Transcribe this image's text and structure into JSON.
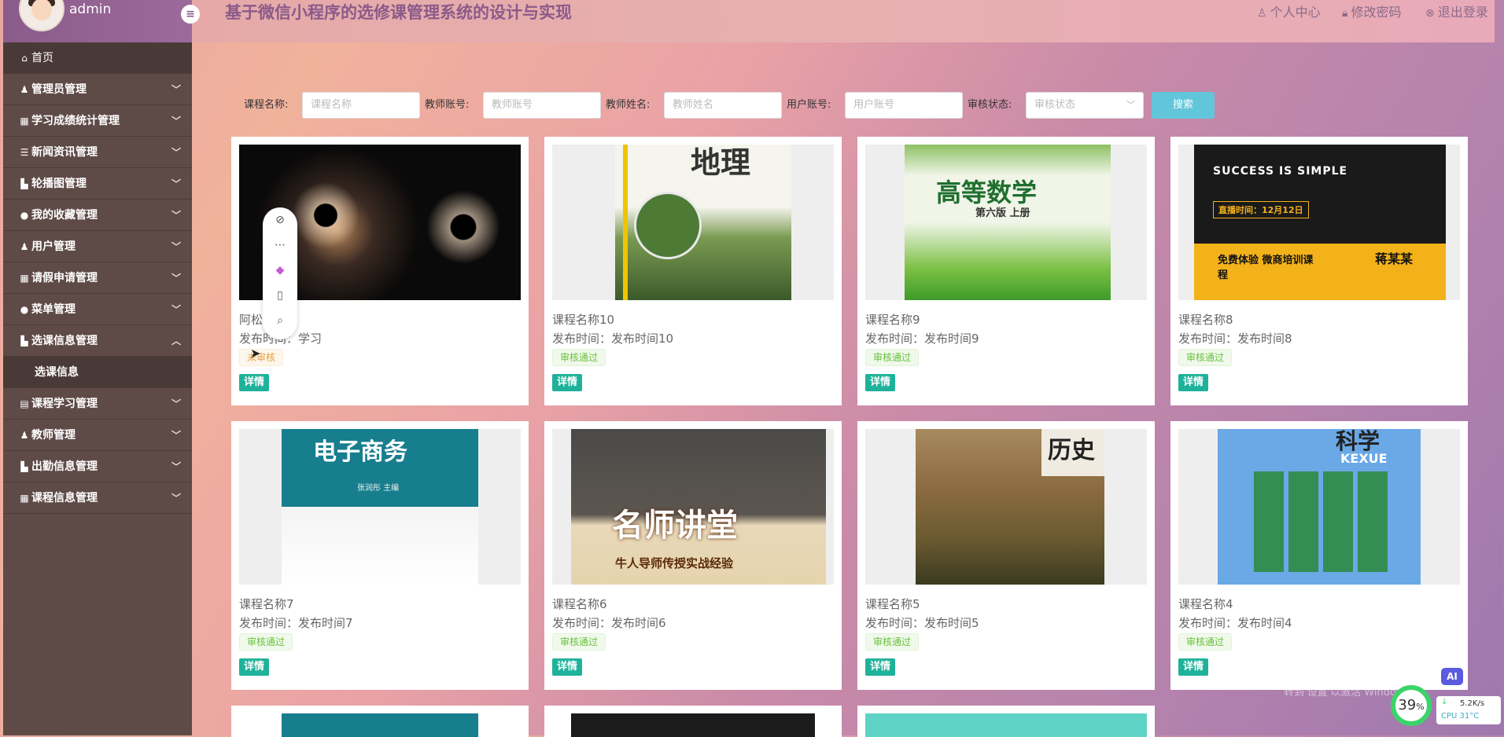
{
  "sidebar": {
    "admin_name": "admin",
    "menu": [
      {
        "label": "首页",
        "icon": "home-icon",
        "glyph": "⌂"
      },
      {
        "label": "管理员管理",
        "icon": "user-icon",
        "glyph": "♟"
      },
      {
        "label": "学习成绩统计管理",
        "icon": "chart-icon",
        "glyph": "▦"
      },
      {
        "label": "新闻资讯管理",
        "icon": "news-icon",
        "glyph": "☰"
      },
      {
        "label": "轮播图管理",
        "icon": "image-icon",
        "glyph": "▙"
      },
      {
        "label": "我的收藏管理",
        "icon": "star-icon",
        "glyph": "●"
      },
      {
        "label": "用户管理",
        "icon": "users-icon",
        "glyph": "♟"
      },
      {
        "label": "请假申请管理",
        "icon": "form-icon",
        "glyph": "▦"
      },
      {
        "label": "菜单管理",
        "icon": "menu-icon",
        "glyph": "●"
      },
      {
        "label": "选课信息管理",
        "icon": "list-icon",
        "glyph": "▙"
      },
      {
        "label": "选课信息",
        "icon": "",
        "glyph": ""
      },
      {
        "label": "课程学习管理",
        "icon": "book-icon",
        "glyph": "▤"
      },
      {
        "label": "教师管理",
        "icon": "teacher-icon",
        "glyph": "♟"
      },
      {
        "label": "出勤信息管理",
        "icon": "calendar-icon",
        "glyph": "▙"
      },
      {
        "label": "课程信息管理",
        "icon": "grid-icon",
        "glyph": "▦"
      }
    ]
  },
  "header": {
    "title": "基于微信小程序的选修课管理系统的设计与实现",
    "links": [
      "个人中心",
      "修改密码",
      "退出登录"
    ]
  },
  "search": {
    "labels": [
      "课程名称:",
      "教师账号:",
      "教师姓名:",
      "用户账号:",
      "审核状态:"
    ],
    "placeholders": [
      "课程名称",
      "教师账号",
      "教师姓名",
      "用户账号",
      "审核状态"
    ],
    "button": "搜索"
  },
  "cards": [
    {
      "title": "阿松大",
      "time": "发布时间：学习",
      "status": "未审核",
      "detail": "详情",
      "thumb": "fireworks"
    },
    {
      "title": "课程名称10",
      "time": "发布时间：发布时间10",
      "status": "审核通过",
      "detail": "详情",
      "thumb": "地理"
    },
    {
      "title": "课程名称9",
      "time": "发布时间：发布时间9",
      "status": "审核通过",
      "detail": "详情",
      "thumb": "高等数学"
    },
    {
      "title": "课程名称8",
      "time": "发布时间：发布时间8",
      "status": "审核通过",
      "detail": "详情",
      "thumb": "SUCCESS IS SIMPLE"
    },
    {
      "title": "课程名称7",
      "time": "发布时间：发布时间7",
      "status": "审核通过",
      "detail": "详情",
      "thumb": "电子商务"
    },
    {
      "title": "课程名称6",
      "time": "发布时间：发布时间6",
      "status": "审核通过",
      "detail": "详情",
      "thumb": "名师讲堂"
    },
    {
      "title": "课程名称5",
      "time": "发布时间：发布时间5",
      "status": "审核通过",
      "detail": "详情",
      "thumb": "历史"
    },
    {
      "title": "课程名称4",
      "time": "发布时间：发布时间4",
      "status": "审核通过",
      "detail": "详情",
      "thumb": "科学"
    }
  ],
  "thumb_text": {
    "geo": "地理",
    "math": "高等数学",
    "math_sub": "第六版 上册",
    "success": "SUCCESS IS SIMPLE",
    "live": "直播时间：12月12日",
    "free": "免费体验 微商培训课程",
    "name": "蒋某某",
    "ecom": "电子商务",
    "ecom_sub": "张润彤  主编",
    "famous": "名师讲堂",
    "famous_sub": "牛人导师传授实战经验",
    "history": "历史",
    "science": "科学",
    "science_en": "KEXUE"
  },
  "overlay": {
    "windows": "激活 Windows",
    "windows_sub": "转到'设置'以激活 Windows",
    "ai": "AI",
    "cpu_percent": "39",
    "cpu_unit": "%",
    "net_speed": "5.2K/s",
    "cpu_temp": "CPU 31°C"
  }
}
